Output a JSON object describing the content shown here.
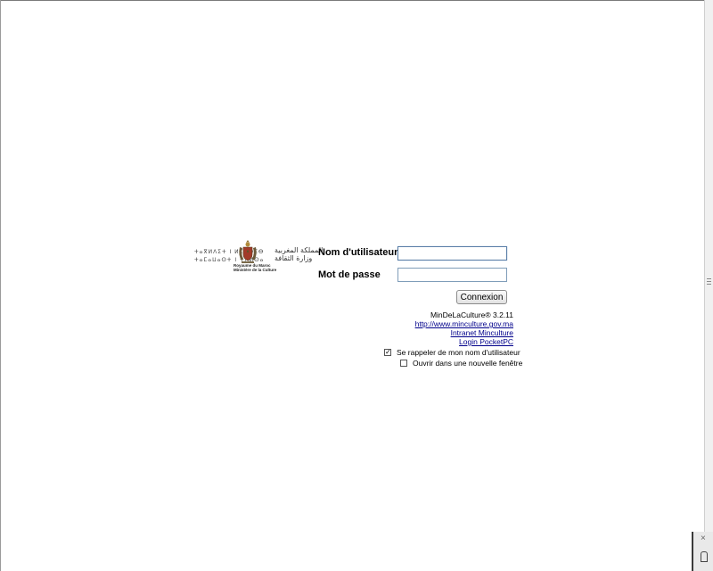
{
  "logo": {
    "tifinagh_line1": "ⵜⴰⴳⵍⴷⵉⵜ ⵏ ⵍⵎⵖⵔⵉⴱ",
    "tifinagh_line2": "ⵜⴰⵎⴰⵡⴰⵙⵜ ⵏ ⵜⴷⵍⵙⴰ",
    "arabic_line1": "المملكة المغربية",
    "arabic_line2": "وزارة الثقافة",
    "french_line1": "Royaume du Maroc",
    "french_line2": "Ministère de la Culture"
  },
  "form": {
    "username_label": "Nom d'utilisateur",
    "username_value": "",
    "password_label": "Mot de passe",
    "password_value": "",
    "submit_label": "Connexion"
  },
  "info": {
    "version": "MinDeLaCulture® 3.2.11",
    "links": [
      "http://www.minculture.gov.ma",
      "Intranet Minculture",
      "Login PocketPC"
    ]
  },
  "options": {
    "remember_label": "Se rappeler de mon nom d'utilisateur",
    "remember_checked": true,
    "new_window_label": "Ouvrir dans une nouvelle fenêtre",
    "new_window_checked": false
  },
  "mini_panel": {
    "close_glyph": "×"
  }
}
